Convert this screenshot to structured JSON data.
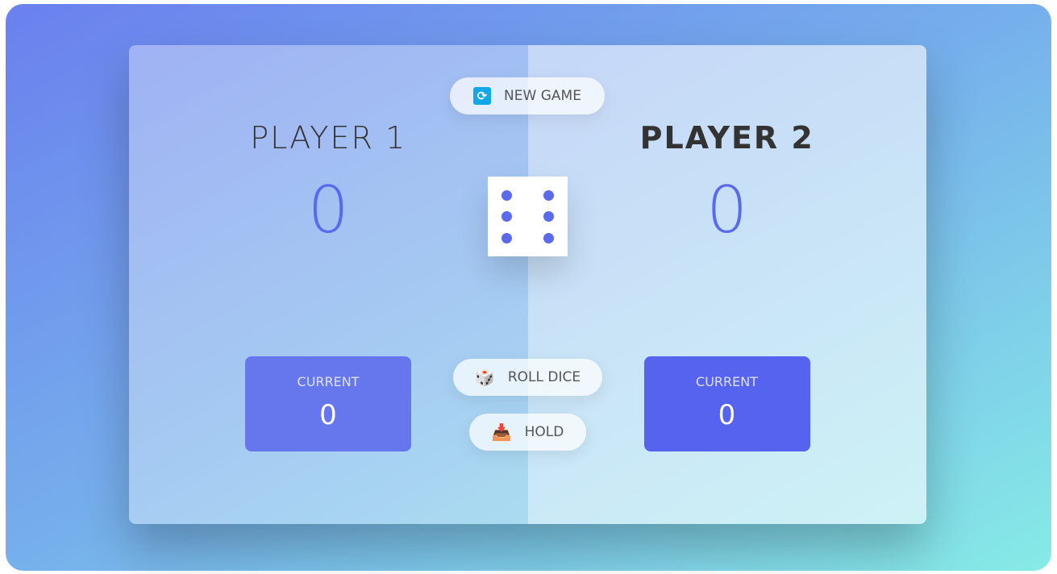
{
  "players": [
    {
      "name": "PLAYER 1",
      "score": "0",
      "current_label": "CURRENT",
      "current": "0",
      "active": false
    },
    {
      "name": "PLAYER 2",
      "score": "0",
      "current_label": "CURRENT",
      "current": "0",
      "active": true
    }
  ],
  "buttons": {
    "new_game": "NEW GAME",
    "roll_dice": "ROLL DICE",
    "hold": "HOLD"
  },
  "icons": {
    "new_game": "refresh-icon",
    "roll_dice": "dice-emoji-icon",
    "hold": "inbox-tray-icon"
  },
  "dice": {
    "value": 6
  },
  "colors": {
    "accent": "#5b6aea",
    "current_active": "#5563ee"
  }
}
